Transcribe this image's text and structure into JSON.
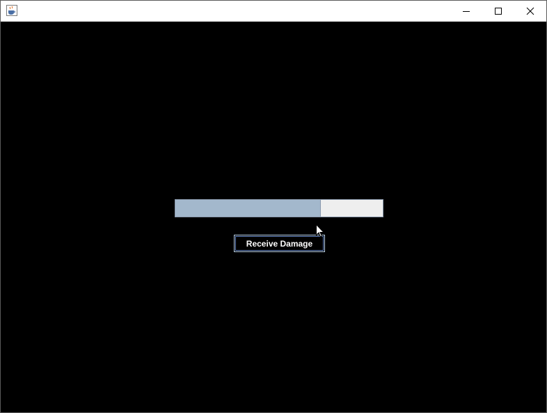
{
  "window": {
    "title": "",
    "controls": {
      "minimize_icon": "minimize-icon",
      "maximize_icon": "maximize-icon",
      "close_icon": "close-icon"
    },
    "app_icon": "java-coffee-cup-icon"
  },
  "health_bar": {
    "value_fraction": 0.7,
    "fill_color": "#a3b8cc",
    "track_color": "#eeeeee"
  },
  "receive_damage_button": {
    "label": "Receive Damage"
  },
  "colors": {
    "background": "#000000",
    "titlebar": "#ffffff",
    "button_text": "#ffffff"
  }
}
